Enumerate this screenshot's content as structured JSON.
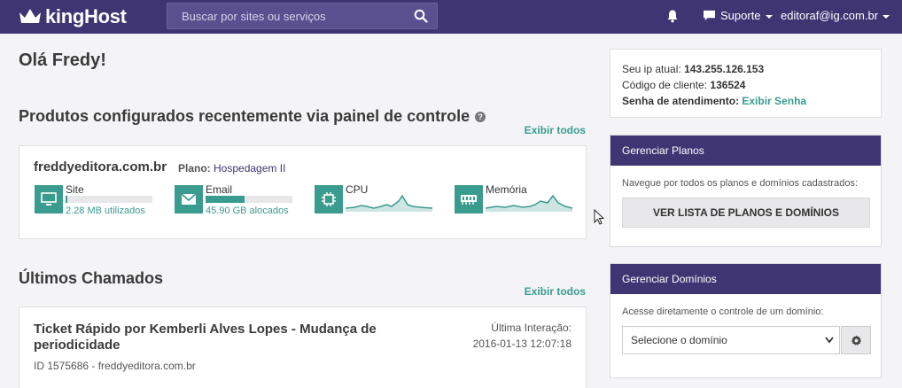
{
  "header": {
    "logo_text": "kingHost",
    "search_placeholder": "Buscar por sites ou serviços",
    "icons": {
      "logo": "crown-icon",
      "search": "search-icon",
      "notifications": "bell-icon",
      "support": "chat-icon"
    },
    "support_label": "Suporte",
    "user_email": "editoraf@ig.com.br"
  },
  "main": {
    "greeting": "Olá Fredy!",
    "products": {
      "title": "Produtos configurados recentemente via painel de controle",
      "view_all": "Exibir todos",
      "item": {
        "domain": "freddyeditora.com.br",
        "plan_label": "Plano:",
        "plan_value": "Hospedagem II",
        "metrics": [
          {
            "label": "Site",
            "usage": "2.28 MB utilizados",
            "fill_percent": 2,
            "icon": "monitor-icon"
          },
          {
            "label": "Email",
            "usage": "45.90 GB alocados",
            "fill_percent": 45,
            "icon": "envelope-icon"
          },
          {
            "label": "CPU",
            "icon": "chip-icon"
          },
          {
            "label": "Memória",
            "icon": "memory-icon"
          }
        ]
      }
    },
    "tickets": {
      "title": "Últimos Chamados",
      "view_all": "Exibir todos",
      "item": {
        "title": "Ticket Rápido por Kemberli Alves Lopes - Mudança de periodicidade",
        "meta": "ID 1575686 - freddyeditora.com.br",
        "last_interaction_label": "Última Interação:",
        "last_interaction_date": "2016-01-13 12:07:18"
      }
    }
  },
  "sidebar": {
    "info": {
      "ip_label": "Seu ip atual:",
      "ip_value": "143.255.126.153",
      "client_label": "Código de cliente:",
      "client_value": "136524",
      "password_label": "Senha de atendimento:",
      "password_link": "Exibir Senha"
    },
    "plans": {
      "title": "Gerenciar Planos",
      "description": "Navegue por todos os planos e domínios cadastrados:",
      "button": "VER LISTA DE PLANOS E DOMÍNIOS"
    },
    "domains": {
      "title": "Gerenciar Domínios",
      "description": "Acesse diretamente o controle de um domínio:",
      "select_value": "Selecione o domínio",
      "settings_icon": "gear-icon"
    }
  },
  "colors": {
    "brand": "#3f3573",
    "accent": "#3a9b8f",
    "background": "#f4f4f6"
  }
}
